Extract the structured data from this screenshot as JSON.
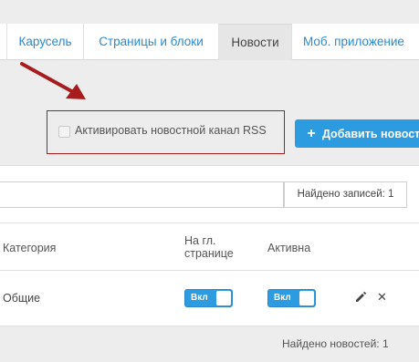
{
  "tabs": [
    {
      "label": ""
    },
    {
      "label": "Карусель"
    },
    {
      "label": "Страницы и блоки"
    },
    {
      "label": "Новости",
      "active": true
    },
    {
      "label": "Моб. приложение"
    }
  ],
  "toolbar": {
    "rss_checkbox_label": "Активировать новостной канал RSS",
    "rss_checked": false,
    "add_button_label": "Добавить новость",
    "add_icon": "plus-icon"
  },
  "search": {
    "value": "",
    "placeholder": "",
    "found_records": "Найдено записей: 1"
  },
  "table": {
    "headers": {
      "category": "Категория",
      "main_page": "На гл. странице",
      "active": "Активна"
    },
    "rows": [
      {
        "category": "Общие",
        "main_page_toggle": "Вкл",
        "active_toggle": "Вкл",
        "edit_icon": "pencil-icon",
        "delete_icon": "close-icon"
      }
    ]
  },
  "footer": {
    "found_news": "Найдено новостей: 1"
  },
  "colors": {
    "accent": "#2d9bdf",
    "tab_text": "#2a8ad2",
    "annotation": "#a71d1d"
  }
}
